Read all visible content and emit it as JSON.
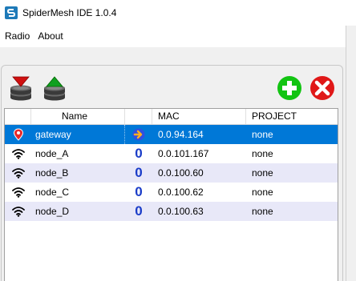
{
  "window": {
    "title": "SpiderMesh IDE 1.0.4",
    "app_icon": "spidermesh-logo-icon"
  },
  "menu": {
    "items": [
      "Radio",
      "About"
    ]
  },
  "toolbar": {
    "left_buttons": [
      "db-download-icon",
      "db-upload-icon"
    ],
    "right_buttons": [
      "add-circle-icon",
      "remove-circle-icon"
    ],
    "colors": {
      "download_arrow": "#d01010",
      "upload_arrow": "#10a020",
      "add": "#12c412",
      "remove": "#e01818"
    }
  },
  "table": {
    "columns": [
      "",
      "Name",
      "",
      "MAC",
      "PROJECT"
    ],
    "rows": [
      {
        "icon": "location-pin-icon",
        "name": "gateway",
        "status": "gateway-arrow-icon",
        "status_text": "",
        "mac": "0.0.94.164",
        "project": "none",
        "selected": true
      },
      {
        "icon": "wifi-icon",
        "name": "node_A",
        "status": "",
        "status_text": "0",
        "mac": "0.0.101.167",
        "project": "none",
        "selected": false
      },
      {
        "icon": "wifi-icon",
        "name": "node_B",
        "status": "",
        "status_text": "0",
        "mac": "0.0.100.60",
        "project": "none",
        "selected": false
      },
      {
        "icon": "wifi-icon",
        "name": "node_C",
        "status": "",
        "status_text": "0",
        "mac": "0.0.100.62",
        "project": "none",
        "selected": false
      },
      {
        "icon": "wifi-icon",
        "name": "node_D",
        "status": "",
        "status_text": "0",
        "mac": "0.0.100.63",
        "project": "none",
        "selected": false
      }
    ],
    "colors": {
      "selected_bg": "#0078d7",
      "alt_row_bg": "#e8e8f8",
      "status_digit": "#1a3cc8"
    }
  }
}
